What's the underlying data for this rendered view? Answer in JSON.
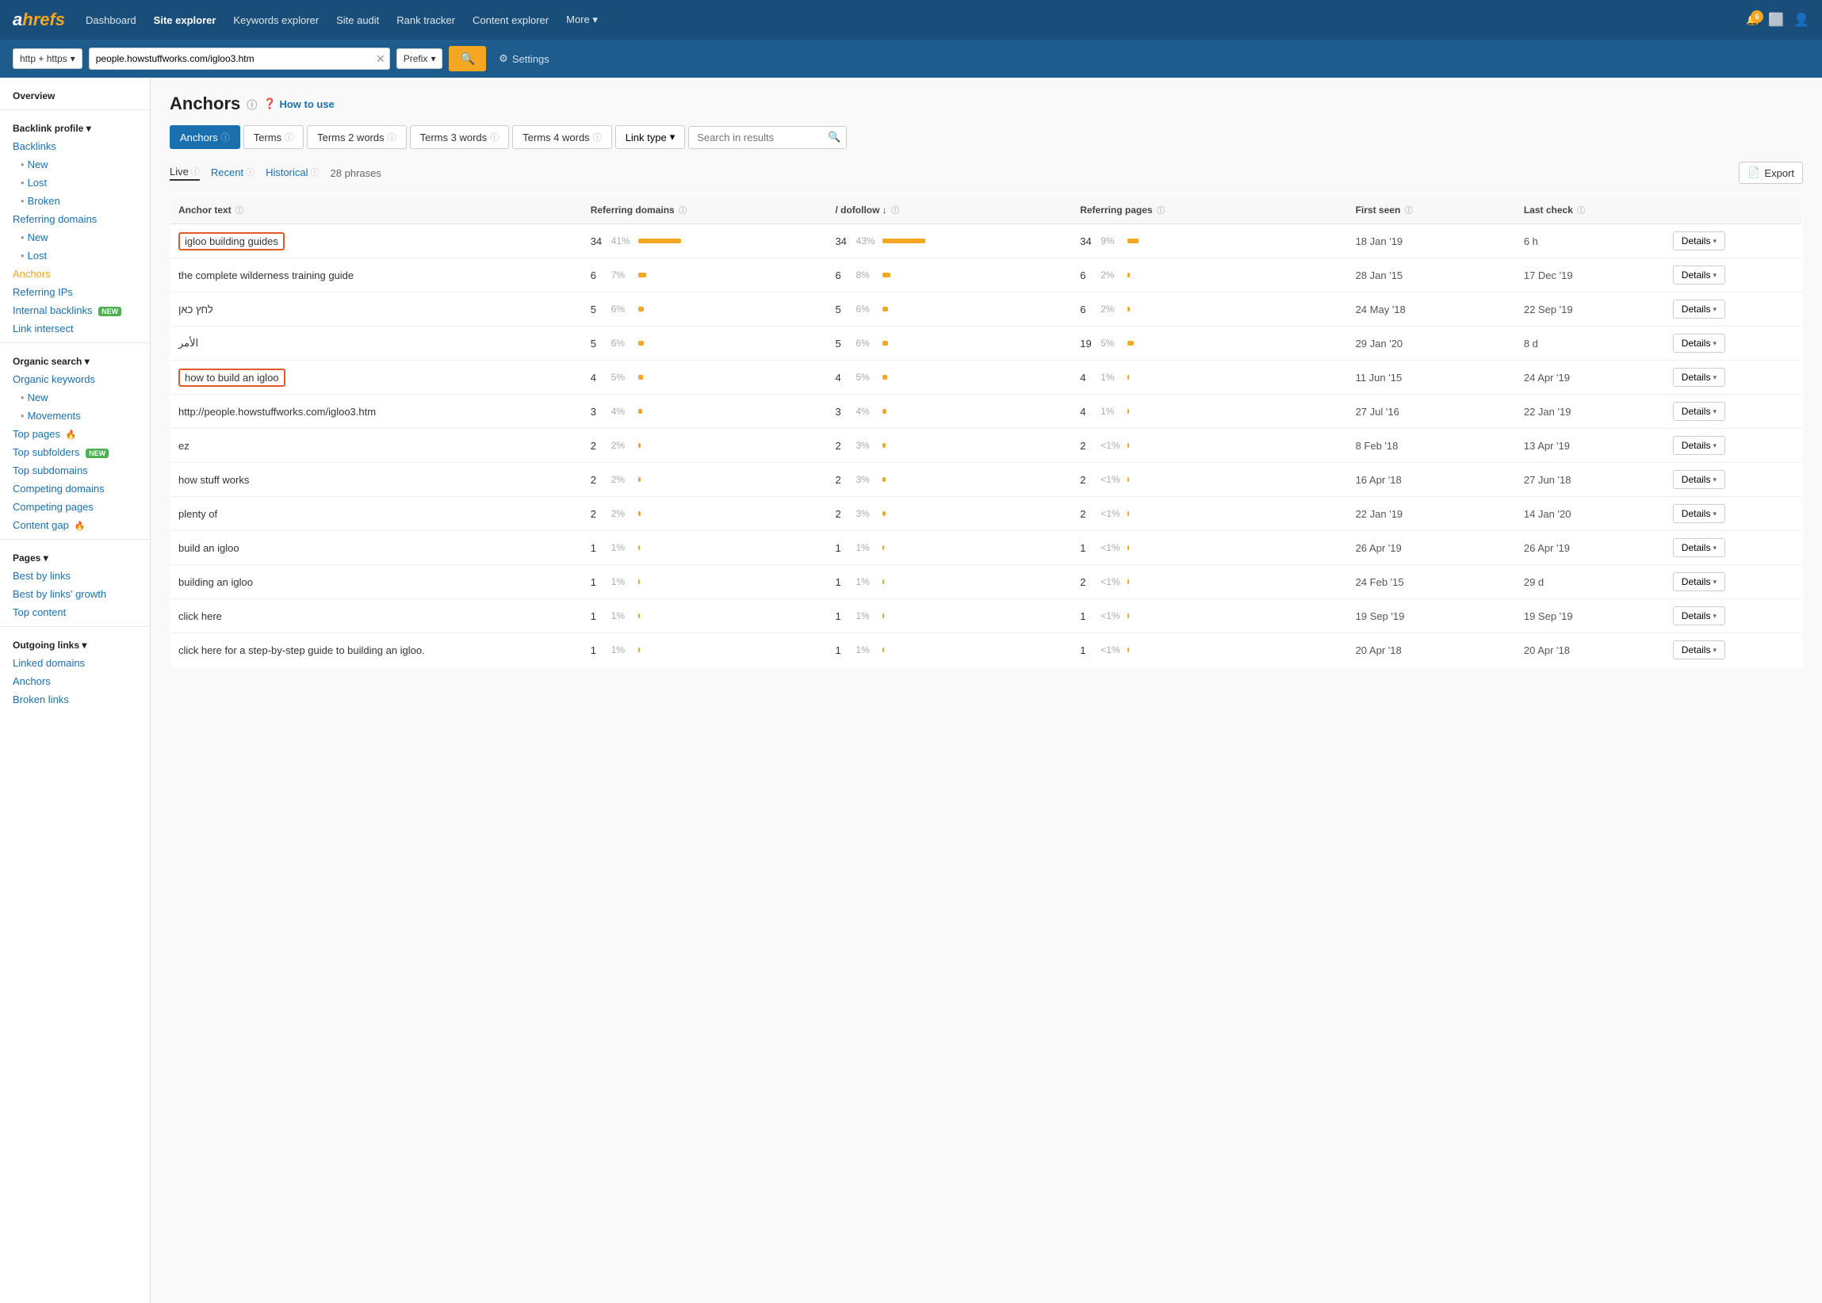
{
  "nav": {
    "logo": "ahrefs",
    "links": [
      "Dashboard",
      "Site explorer",
      "Keywords explorer",
      "Site audit",
      "Rank tracker",
      "Content explorer",
      "More ▾"
    ],
    "active_link": "Site explorer",
    "bell_count": "6"
  },
  "searchbar": {
    "protocol": "http + https",
    "url": "people.howstuffworks.com/igloo3.htm",
    "mode": "Prefix",
    "settings_label": "Settings"
  },
  "sidebar": {
    "overview": "Overview",
    "backlink_profile": "Backlink profile ▾",
    "backlinks": "Backlinks",
    "new": "New",
    "lost": "Lost",
    "broken": "Broken",
    "referring_domains": "Referring domains",
    "referring_new": "New",
    "referring_lost": "Lost",
    "anchors": "Anchors",
    "referring_ips": "Referring IPs",
    "internal_backlinks": "Internal backlinks",
    "link_intersect": "Link intersect",
    "organic_search": "Organic search ▾",
    "organic_keywords": "Organic keywords",
    "organic_new": "New",
    "organic_movements": "Movements",
    "top_pages": "Top pages",
    "top_subfolders": "Top subfolders",
    "top_subdomains": "Top subdomains",
    "competing_domains": "Competing domains",
    "competing_pages": "Competing pages",
    "content_gap": "Content gap",
    "pages": "Pages ▾",
    "best_by_links": "Best by links",
    "best_by_links_growth": "Best by links' growth",
    "top_content": "Top content",
    "outgoing_links": "Outgoing links ▾",
    "linked_domains": "Linked domains",
    "outgoing_anchors": "Anchors",
    "broken_links": "Broken links"
  },
  "page": {
    "title": "Anchors",
    "how_to_use": "How to use"
  },
  "tabs": {
    "items": [
      "Anchors",
      "Terms",
      "Terms 2 words",
      "Terms 3 words",
      "Terms 4 words"
    ],
    "active": "Anchors",
    "link_type": "Link type",
    "search_placeholder": "Search in results"
  },
  "data_bar": {
    "live": "Live",
    "recent": "Recent",
    "historical": "Historical",
    "phrases": "28 phrases",
    "export": "Export"
  },
  "table": {
    "headers": [
      "Anchor text",
      "Referring domains",
      "/ dofollow ↓",
      "Referring pages",
      "First seen",
      "Last check"
    ],
    "rows": [
      {
        "anchor": "igloo building guides",
        "highlighted": true,
        "rd_num": "34",
        "rd_pct": "41%",
        "rd_bar": 90,
        "df_num": "34",
        "df_pct": "43%",
        "df_bar": 90,
        "rp_num": "34",
        "rp_pct": "9%",
        "rp_bar": 24,
        "first_seen": "18 Jan '19",
        "last_check": "6 h"
      },
      {
        "anchor": "the complete wilderness training guide",
        "highlighted": false,
        "rd_num": "6",
        "rd_pct": "7%",
        "rd_bar": 16,
        "df_num": "6",
        "df_pct": "8%",
        "df_bar": 16,
        "rp_num": "6",
        "rp_pct": "2%",
        "rp_bar": 5,
        "first_seen": "28 Jan '15",
        "last_check": "17 Dec '19"
      },
      {
        "anchor": "לחץ כאן",
        "highlighted": false,
        "rd_num": "5",
        "rd_pct": "6%",
        "rd_bar": 12,
        "df_num": "5",
        "df_pct": "6%",
        "df_bar": 12,
        "rp_num": "6",
        "rp_pct": "2%",
        "rp_bar": 5,
        "first_seen": "24 May '18",
        "last_check": "22 Sep '19"
      },
      {
        "anchor": "الأمر",
        "highlighted": false,
        "rd_num": "5",
        "rd_pct": "6%",
        "rd_bar": 12,
        "df_num": "5",
        "df_pct": "6%",
        "df_bar": 12,
        "rp_num": "19",
        "rp_pct": "5%",
        "rp_bar": 14,
        "first_seen": "29 Jan '20",
        "last_check": "8 d"
      },
      {
        "anchor": "how to build an igloo",
        "highlighted": true,
        "rd_num": "4",
        "rd_pct": "5%",
        "rd_bar": 10,
        "df_num": "4",
        "df_pct": "5%",
        "df_bar": 10,
        "rp_num": "4",
        "rp_pct": "1%",
        "rp_bar": 3,
        "first_seen": "11 Jun '15",
        "last_check": "24 Apr '19"
      },
      {
        "anchor": "http://people.howstuffworks.com/igloo3.htm",
        "highlighted": false,
        "rd_num": "3",
        "rd_pct": "4%",
        "rd_bar": 8,
        "df_num": "3",
        "df_pct": "4%",
        "df_bar": 8,
        "rp_num": "4",
        "rp_pct": "1%",
        "rp_bar": 3,
        "first_seen": "27 Jul '16",
        "last_check": "22 Jan '19"
      },
      {
        "anchor": "ez",
        "highlighted": false,
        "rd_num": "2",
        "rd_pct": "2%",
        "rd_bar": 5,
        "df_num": "2",
        "df_pct": "3%",
        "df_bar": 6,
        "rp_num": "2",
        "rp_pct": "<1%",
        "rp_bar": 2,
        "first_seen": "8 Feb '18",
        "last_check": "13 Apr '19"
      },
      {
        "anchor": "how stuff works",
        "highlighted": false,
        "rd_num": "2",
        "rd_pct": "2%",
        "rd_bar": 5,
        "df_num": "2",
        "df_pct": "3%",
        "df_bar": 6,
        "rp_num": "2",
        "rp_pct": "<1%",
        "rp_bar": 2,
        "first_seen": "16 Apr '18",
        "last_check": "27 Jun '18"
      },
      {
        "anchor": "plenty of",
        "highlighted": false,
        "rd_num": "2",
        "rd_pct": "2%",
        "rd_bar": 5,
        "df_num": "2",
        "df_pct": "3%",
        "df_bar": 6,
        "rp_num": "2",
        "rp_pct": "<1%",
        "rp_bar": 2,
        "first_seen": "22 Jan '19",
        "last_check": "14 Jan '20"
      },
      {
        "anchor": "build an igloo",
        "highlighted": false,
        "rd_num": "1",
        "rd_pct": "1%",
        "rd_bar": 2,
        "df_num": "1",
        "df_pct": "1%",
        "df_bar": 2,
        "rp_num": "1",
        "rp_pct": "<1%",
        "rp_bar": 1,
        "first_seen": "26 Apr '19",
        "last_check": "26 Apr '19"
      },
      {
        "anchor": "building an igloo",
        "highlighted": false,
        "rd_num": "1",
        "rd_pct": "1%",
        "rd_bar": 2,
        "df_num": "1",
        "df_pct": "1%",
        "df_bar": 2,
        "rp_num": "2",
        "rp_pct": "<1%",
        "rp_bar": 1,
        "first_seen": "24 Feb '15",
        "last_check": "29 d"
      },
      {
        "anchor": "click here",
        "highlighted": false,
        "rd_num": "1",
        "rd_pct": "1%",
        "rd_bar": 2,
        "df_num": "1",
        "df_pct": "1%",
        "df_bar": 2,
        "rp_num": "1",
        "rp_pct": "<1%",
        "rp_bar": 1,
        "first_seen": "19 Sep '19",
        "last_check": "19 Sep '19"
      },
      {
        "anchor": "click here for a step-by-step guide to building an igloo.",
        "highlighted": false,
        "rd_num": "1",
        "rd_pct": "1%",
        "rd_bar": 2,
        "df_num": "1",
        "df_pct": "1%",
        "df_bar": 2,
        "rp_num": "1",
        "rp_pct": "<1%",
        "rp_bar": 1,
        "first_seen": "20 Apr '18",
        "last_check": "20 Apr '18"
      }
    ]
  }
}
